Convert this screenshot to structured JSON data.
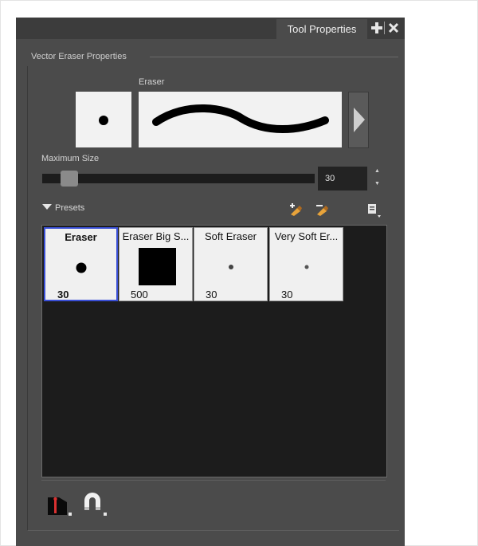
{
  "panel": {
    "tab_title": "Tool Properties",
    "section_title": "Vector Eraser Properties",
    "preview_label": "Eraser",
    "max_size_label": "Maximum Size",
    "max_size_value": "30",
    "max_size_slider_fraction": 0.08,
    "presets_label": "Presets"
  },
  "presets": [
    {
      "name": "Eraser",
      "size": "30",
      "selected": true
    },
    {
      "name": "Eraser Big S...",
      "size": "500",
      "selected": false
    },
    {
      "name": "Soft Eraser",
      "size": "30",
      "selected": false
    },
    {
      "name": "Very Soft Er...",
      "size": "30",
      "selected": false
    }
  ],
  "icons": {
    "add_tab": "plus-icon",
    "close_tab": "close-icon",
    "new_preset": "new-preset-icon",
    "delete_preset": "delete-preset-icon",
    "preset_menu": "menu-icon",
    "create_mode": "eraser-mode-icon",
    "snap": "magnet-icon"
  },
  "colors": {
    "panel_bg": "#4b4b4b",
    "selected_border": "#3a4fd6"
  }
}
